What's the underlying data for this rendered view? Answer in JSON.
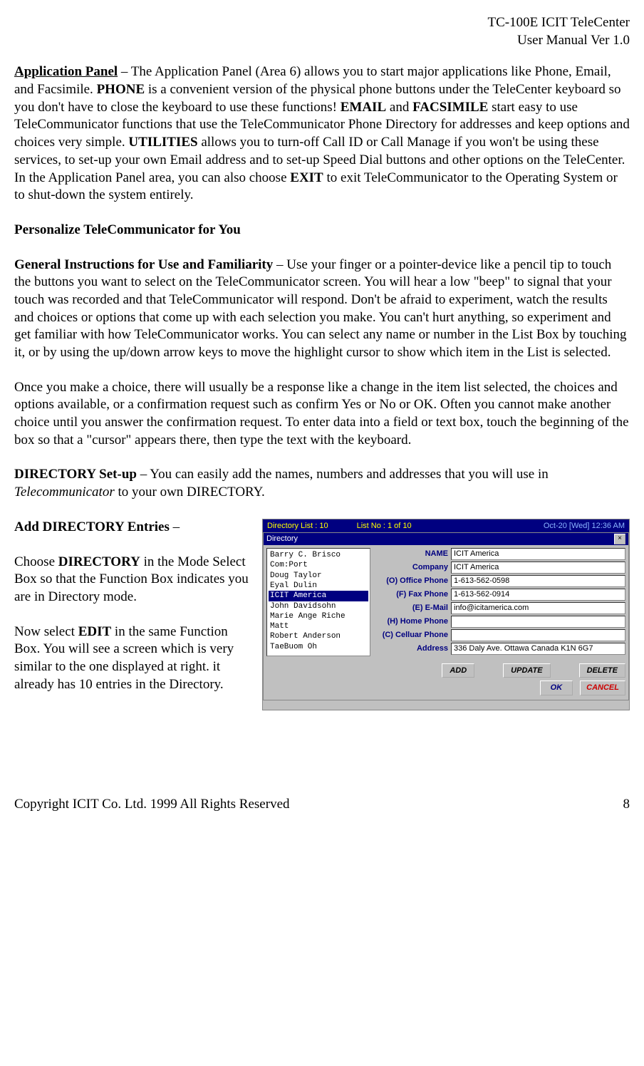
{
  "header": {
    "line1": "TC-100E ICIT TeleCenter",
    "line2": "User Manual  Ver 1.0"
  },
  "p1": {
    "lead_u": "Application Panel",
    "t1": " – The Application Panel (Area 6) allows you to start major applications like Phone, Email, and Facsimile. ",
    "b1": "PHONE",
    "t2": " is a convenient version of the physical phone buttons under the TeleCenter keyboard so you don't have to close the keyboard to use these functions! ",
    "b2": "EMAIL",
    "t3": " and ",
    "b3": "FACSIMILE",
    "t4": " start easy to use TeleCommunicator functions that use the TeleCommunicator Phone Directory for addresses and keep options and choices very simple. ",
    "b4": "UTILITIES",
    "t5": " allows you to turn-off Call ID or Call Manage if you won't be using these services, to set-up your own Email address and to set-up Speed Dial buttons and other options on the TeleCenter. In the Application Panel area, you can also choose ",
    "b5": "EXIT",
    "t6": " to exit TeleCommunicator to the Operating System or to shut-down the system entirely."
  },
  "p2": {
    "b1": "Personalize TeleCommunicator for You"
  },
  "p3": {
    "b1": "General Instructions for Use and Familiarity",
    "t1": " – Use your finger or a pointer-device like a pencil tip to touch the buttons you want to select on the TeleCommunicator screen. You will hear a low \"beep\" to signal that your touch was recorded and that TeleCommunicator will respond. Don't be afraid to experiment, watch the results and choices or options that come up with each selection you make. You can't hurt anything, so experiment and get familiar with how TeleCommunicator works. You can select any name or number in the List Box by touching it, or by using the up/down arrow keys to move the highlight cursor to show which item in the List is selected."
  },
  "p4": {
    "t1": "Once you make a choice, there will usually be a response like a change in the item list selected, the choices and options available, or a confirmation request such as confirm Yes or No or OK. Often you cannot make another choice until you answer the confirmation request. To enter data into a field or text box, touch the beginning of the box so that a \"cursor\" appears there, then type the text with the keyboard."
  },
  "p5": {
    "b1": "DIRECTORY Set-up",
    "t1": " – You can easily add the names, numbers and addresses that you will use in ",
    "i1": "Telecommunicator",
    "t2": " to your own DIRECTORY."
  },
  "p6": {
    "b1": "Add DIRECTORY Entries",
    "t1": " –"
  },
  "p7": {
    "t1": "Choose ",
    "b1": "DIRECTORY",
    "t2": " in the Mode Select Box so that the Function Box indicates you are in Directory mode."
  },
  "p8": {
    "t1": "Now select ",
    "b1": "EDIT",
    "t2": " in the same Function Box. You will see a screen which is very similar to the one displayed at right. it already has 10 entries in the Directory."
  },
  "screenshot": {
    "titlebar": {
      "left": "Directory List : 10",
      "mid": "List No : 1 of 10",
      "right": "Oct-20 [Wed] 12:36 AM"
    },
    "window_title": "Directory",
    "close": "×",
    "list": [
      "Barry C. Brisco",
      "Com:Port",
      "Doug Taylor",
      "Eyal Dulin",
      "ICIT America",
      "John Davidsohn",
      "Marie Ange Riche",
      "Matt",
      "Robert Anderson",
      "TaeBuom Oh"
    ],
    "selected_index": 4,
    "fields": [
      {
        "label": "NAME",
        "value": "ICIT America"
      },
      {
        "label": "Company",
        "value": "ICIT America"
      },
      {
        "label": "(O) Office Phone",
        "value": "1-613-562-0598"
      },
      {
        "label": "(F) Fax Phone",
        "value": "1-613-562-0914"
      },
      {
        "label": "(E) E-Mail",
        "value": "info@icitamerica.com"
      },
      {
        "label": "(H) Home Phone",
        "value": ""
      },
      {
        "label": "(C) Celluar Phone",
        "value": ""
      },
      {
        "label": "Address",
        "value": "336 Daly Ave. Ottawa Canada K1N 6G7"
      }
    ],
    "buttons": {
      "add": "ADD",
      "update": "UPDATE",
      "delete": "DELETE",
      "ok": "OK",
      "cancel": "CANCEL"
    }
  },
  "footer": {
    "copyright": "Copyright ICIT Co. Ltd. 1999  All Rights Reserved",
    "page": "8"
  }
}
